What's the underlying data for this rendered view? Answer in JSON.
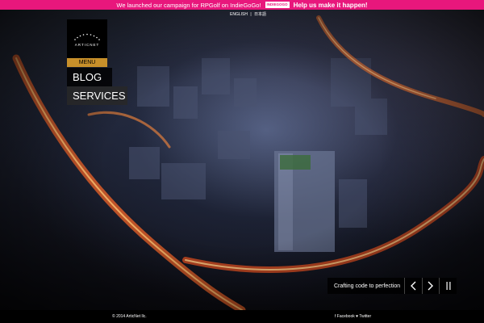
{
  "banner": {
    "message": "We launched our campaign for RPGolf on IndieGoGo!",
    "logo_text": "INDIEGOGO",
    "cta": "Help us make it happen!"
  },
  "language": {
    "english": "ENGLISH",
    "separator": "|",
    "japanese": "日本語"
  },
  "logo": {
    "name": "ARTICNET"
  },
  "nav": {
    "menu_label": "MENU",
    "blog": "BLOG",
    "services": "SERVICES"
  },
  "slider": {
    "caption": "Crafting code to perfection"
  },
  "footer": {
    "copyright": "© 2014 ArticNet llc.",
    "facebook": "f Facebook",
    "twitter": "♥ Twitter"
  },
  "colors": {
    "banner": "#e8177c",
    "menu_tab": "#c8902a"
  }
}
